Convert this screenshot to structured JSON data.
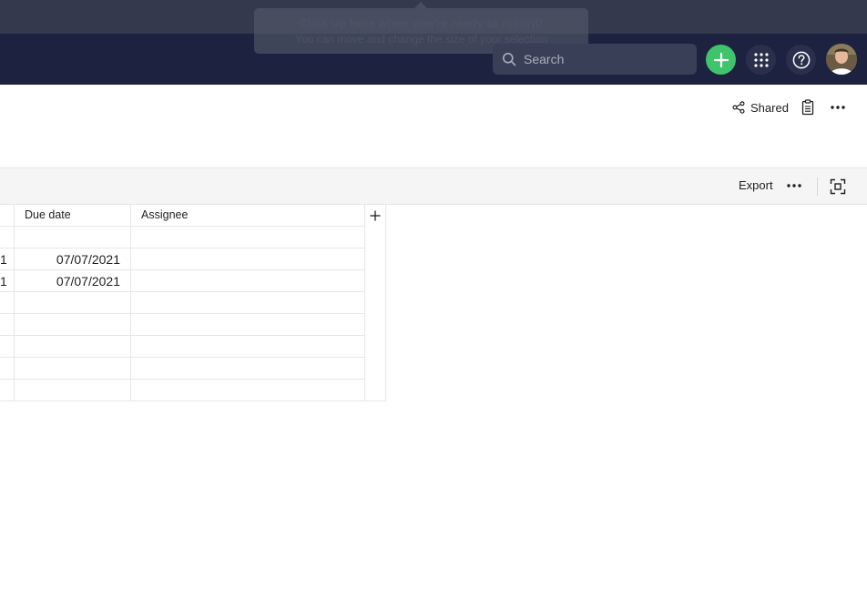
{
  "recorder": {
    "title": "Click up here when you're ready to record!",
    "subtitle": "You can move and change the size of your selection"
  },
  "topbar": {
    "search_placeholder": "Search",
    "icons": [
      "search-icon",
      "plus-icon",
      "apps-grid-icon",
      "help-icon",
      "avatar"
    ],
    "accent_color": "#3fc36b",
    "background_color": "#1d2240"
  },
  "project_header": {
    "shared_label": "Shared"
  },
  "toolbar": {
    "export_label": "Export"
  },
  "table": {
    "columns": [
      "Due date",
      "Assignee"
    ],
    "rows": [
      {
        "edge": "",
        "due_date": "",
        "assignee": ""
      },
      {
        "edge": "1",
        "due_date": "07/07/2021",
        "assignee": ""
      },
      {
        "edge": "1",
        "due_date": "07/07/2021",
        "assignee": ""
      },
      {
        "edge": "",
        "due_date": "",
        "assignee": ""
      },
      {
        "edge": "",
        "due_date": "",
        "assignee": ""
      },
      {
        "edge": "",
        "due_date": "",
        "assignee": ""
      },
      {
        "edge": "",
        "due_date": "",
        "assignee": ""
      },
      {
        "edge": "",
        "due_date": "",
        "assignee": ""
      }
    ]
  }
}
